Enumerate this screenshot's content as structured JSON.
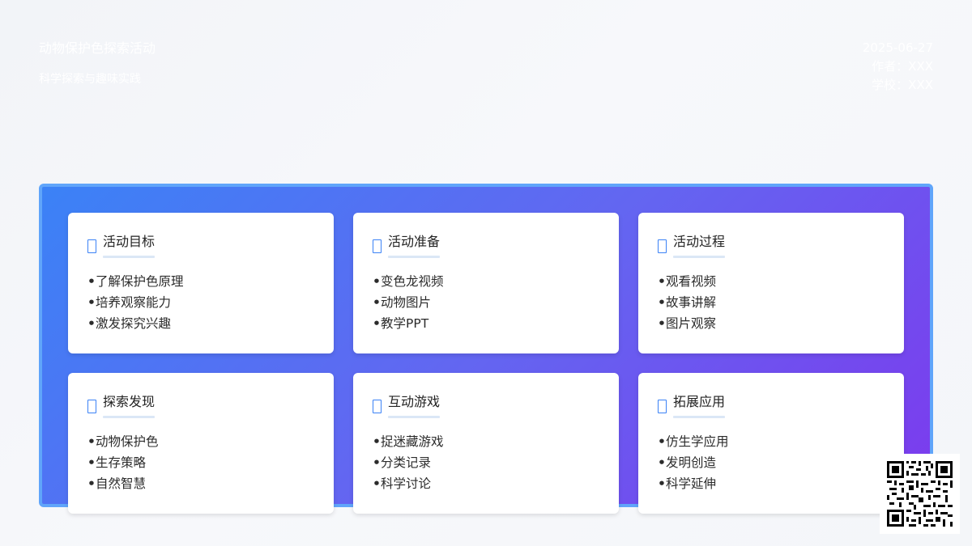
{
  "header": {
    "title": "动物保护色探索活动",
    "subtitle": "科学探索与趣味实践",
    "date": "2025-06-27",
    "author": "作者：XXX",
    "school": "学校：XXX"
  },
  "cards": [
    {
      "title": "活动目标",
      "items": [
        "了解保护色原理",
        "培养观察能力",
        "激发探究兴趣"
      ]
    },
    {
      "title": "活动准备",
      "items": [
        "变色龙视频",
        "动物图片",
        "教学PPT"
      ]
    },
    {
      "title": "活动过程",
      "items": [
        "观看视频",
        "故事讲解",
        "图片观察"
      ]
    },
    {
      "title": "探索发现",
      "items": [
        "动物保护色",
        "生存策略",
        "自然智慧"
      ]
    },
    {
      "title": "互动游戏",
      "items": [
        "捉迷藏游戏",
        "分类记录",
        "科学讨论"
      ]
    },
    {
      "title": "拓展应用",
      "items": [
        "仿生学应用",
        "发明创造",
        "科学延伸"
      ]
    }
  ],
  "bullet": "•",
  "colors": {
    "panel_gradient_start": "#3b82f6",
    "panel_gradient_end": "#7c3aed",
    "panel_border": "#60a5fa",
    "icon_accent": "#3b82f6"
  },
  "icons": {
    "card_icon": "document-icon",
    "qr": "qr-code"
  }
}
